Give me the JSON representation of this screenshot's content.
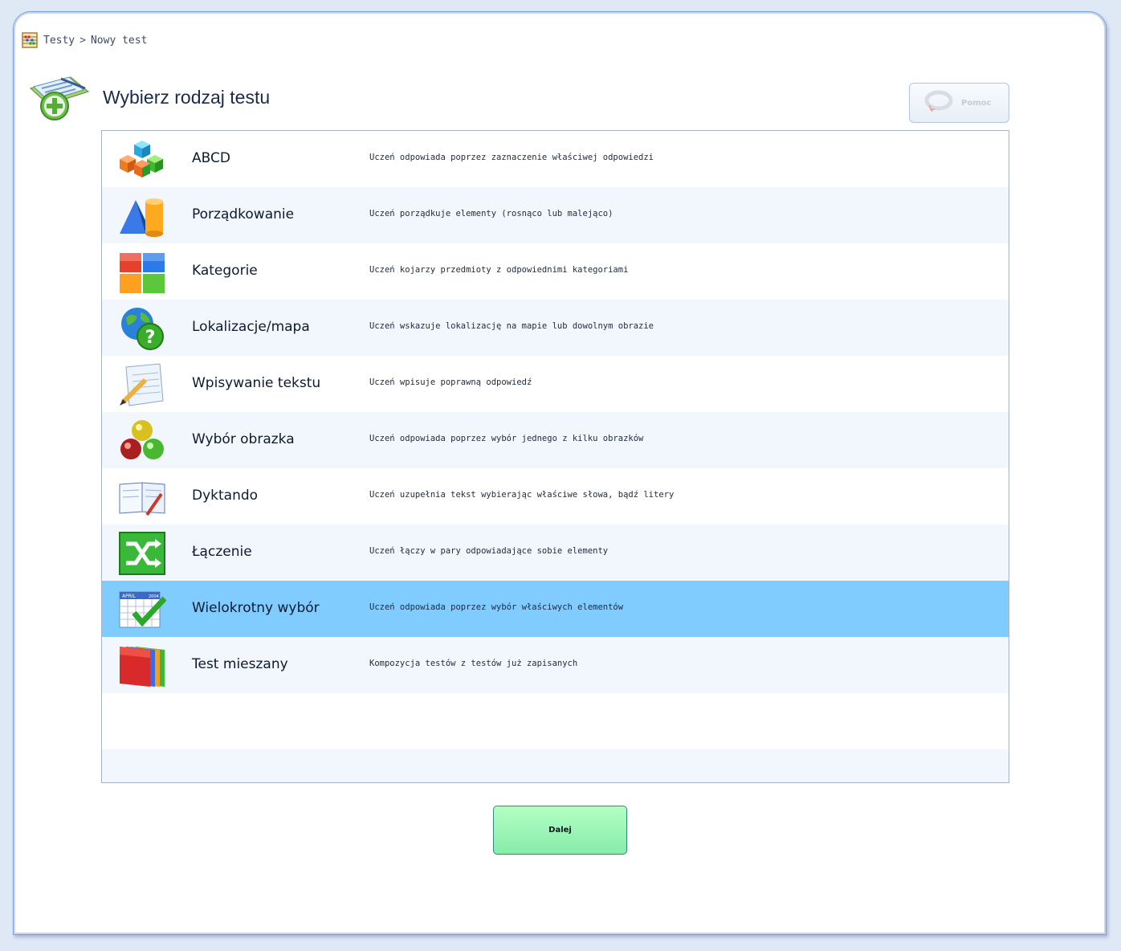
{
  "breadcrumb": {
    "items": [
      "Testy",
      "Nowy test"
    ],
    "separator": ">"
  },
  "header": {
    "title": "Wybierz rodzaj testu",
    "help_label": "Pomoc"
  },
  "test_types": [
    {
      "name": "ABCD",
      "description": "Uczeń odpowiada poprzez zaznaczenie właściwej odpowiedzi",
      "icon": "cubes-icon"
    },
    {
      "name": "Porządkowanie",
      "description": "Uczeń porządkuje elementy (rosnąco lub malejąco)",
      "icon": "shapes-icon"
    },
    {
      "name": "Kategorie",
      "description": "Uczeń kojarzy przedmioty z odpowiednimi kategoriami",
      "icon": "categories-icon"
    },
    {
      "name": "Lokalizacje/mapa",
      "description": "Uczeń wskazuje lokalizację na mapie lub dowolnym obrazie",
      "icon": "globe-question-icon"
    },
    {
      "name": "Wpisywanie tekstu",
      "description": "Uczeń wpisuje poprawną odpowiedź",
      "icon": "notepad-pencil-icon"
    },
    {
      "name": "Wybór obrazka",
      "description": "Uczeń odpowiada poprzez wybór jednego z kilku obrazków",
      "icon": "balls-icon"
    },
    {
      "name": "Dyktando",
      "description": "Uczeń uzupełnia tekst wybierając właściwe słowa, bądź litery",
      "icon": "book-pen-icon"
    },
    {
      "name": "Łączenie",
      "description": "Uczeń łączy w pary odpowiadające sobie elementy",
      "icon": "shuffle-icon"
    },
    {
      "name": "Wielokrotny wybór",
      "description": "Uczeń odpowiada poprzez wybór właściwych elementów",
      "icon": "calendar-check-icon",
      "calendar_month": "APRIL",
      "calendar_year": "2004"
    },
    {
      "name": "Test mieszany",
      "description": "Kompozycja testów z testów już zapisanych",
      "icon": "folders-icon"
    }
  ],
  "selected_index": 8,
  "footer": {
    "next_label": "Dalej"
  },
  "colors": {
    "selected_row": "#80cbff",
    "alt_row": "#f2f6fd",
    "next_button": "#9ef5b8"
  }
}
